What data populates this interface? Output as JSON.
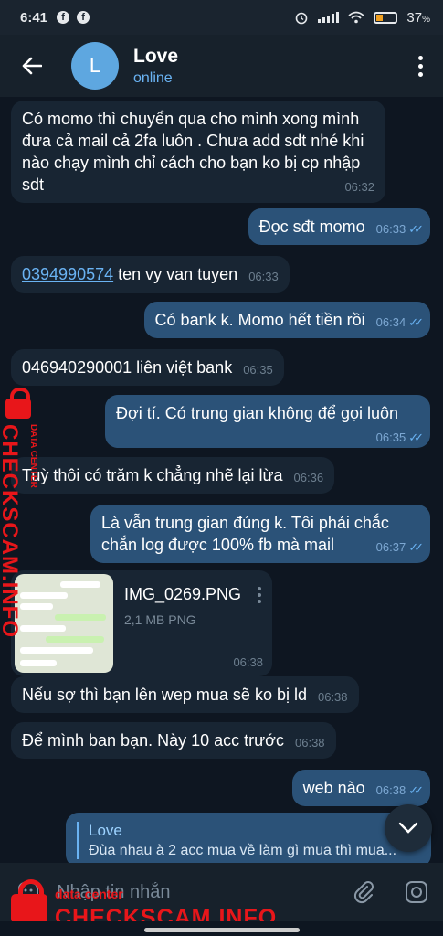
{
  "status_bar": {
    "time": "6:41",
    "fb_glyph": "f",
    "battery": "37",
    "battery_unit": "%",
    "battery_level": 0.37
  },
  "header": {
    "back_icon": "arrow-left-icon",
    "avatar_letter": "L",
    "title": "Love",
    "status": "online"
  },
  "messages": [
    {
      "dir": "in",
      "text": "Có momo thì chuyển qua cho mình xong mình đưa cả mail cả 2fa luôn . Chưa add sdt nhé khi nào chạy mình chỉ cách cho bạn ko bị cp nhập sdt",
      "time": "06:32"
    },
    {
      "dir": "out",
      "text": "Đọc sđt momo",
      "time": "06:33"
    },
    {
      "dir": "in",
      "link": "0394990574",
      "text": " ten vy van tuyen",
      "time": "06:33"
    },
    {
      "dir": "out",
      "text": "Có bank k. Momo hết tiền rồi",
      "time": "06:34"
    },
    {
      "dir": "in",
      "text": "046940290001 liên việt bank",
      "time": "06:35"
    },
    {
      "dir": "out",
      "text": "Đợi tí. Có trung gian không để gọi luôn",
      "time": "06:35"
    },
    {
      "dir": "in",
      "text": "Tuỳ thôi có trăm k chẳng nhẽ lại lừa",
      "time": "06:36"
    },
    {
      "dir": "out",
      "text": "Là vẫn trung gian đúng k. Tôi phải chắc chắn log được 100% fb mà mail",
      "time": "06:37"
    },
    {
      "dir": "in",
      "text": "Nếu sợ thì bạn lên wep mua sẽ ko bị ld",
      "time": "06:38"
    },
    {
      "dir": "in",
      "text": "Để mình ban bạn. Này 10 acc trước",
      "time": "06:38"
    },
    {
      "dir": "out",
      "text": "web nào",
      "time": "06:38"
    }
  ],
  "file": {
    "name": "IMG_0269.PNG",
    "size": "2,1 MB PNG",
    "time": "06:38"
  },
  "reply_preview": {
    "name": "Love",
    "text": "Đùa nhau à 2 acc mua về làm gì mua thì mua..."
  },
  "input": {
    "placeholder": "Nhập tin nhắn"
  },
  "watermark": {
    "side_big": "CHECKSCAM.INFO",
    "side_small": "DATA CENTER",
    "bottom_big": "CHECKSCAM.INFO",
    "bottom_small": "data center"
  },
  "colors": {
    "background": "#0e1621",
    "incoming": "#182533",
    "outgoing": "#2b5278",
    "accent": "#6ab3f3",
    "watermark": "#e8161a"
  }
}
